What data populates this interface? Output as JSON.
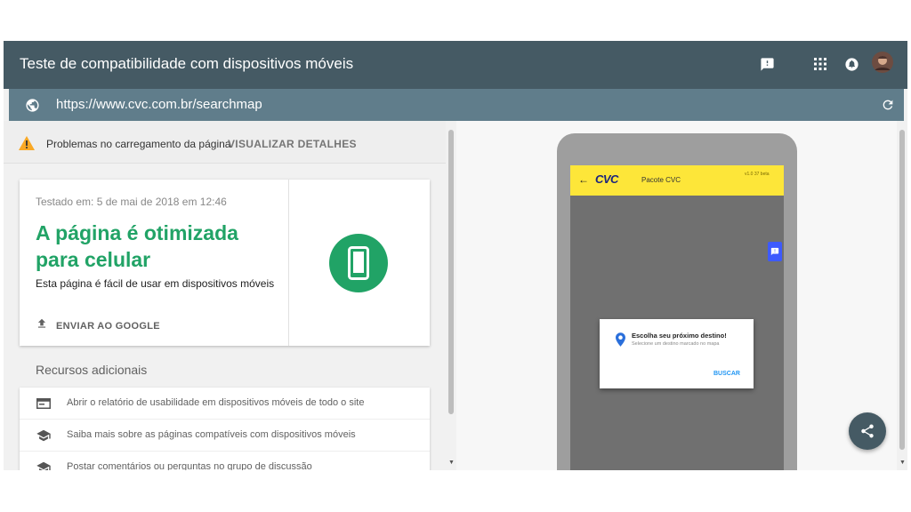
{
  "app": {
    "title": "Teste de compatibilidade com dispositivos móveis"
  },
  "header_icons": [
    "feedback-icon",
    "apps-grid-icon",
    "notifications-icon",
    "account-avatar"
  ],
  "url_bar": {
    "url": "https://www.cvc.com.br/searchmap"
  },
  "warning": {
    "text": "Problemas no carregamento da página",
    "link": "VISUALIZAR DETALHES"
  },
  "result": {
    "tested": "Testado em: 5 de mai de 2018 em 12:46",
    "headline": "A página é otimizada para celular",
    "subtitle": "Esta página é fácil de usar em dispositivos móveis",
    "submit": "ENVIAR AO GOOGLE"
  },
  "resources": {
    "title": "Recursos adicionais",
    "items": [
      {
        "label": "Abrir o relatório de usabilidade em dispositivos móveis de todo o site",
        "icon": "report-icon"
      },
      {
        "label": "Saiba mais sobre as páginas compatíveis com dispositivos móveis",
        "icon": "school-icon"
      },
      {
        "label": "Postar comentários ou perguntas no grupo de discussão",
        "icon": "school-icon"
      }
    ]
  },
  "preview": {
    "logo": "CVC",
    "page_title": "Pacote CVC",
    "version": "v1.0 37 beta",
    "dialog_title": "Escolha seu próximo destino!",
    "dialog_subtitle": "Selecione um destino marcado no mapa",
    "dialog_button": "BUSCAR"
  },
  "colors": {
    "appbar": "#455a64",
    "urlbar": "#607d8b",
    "success": "#21a366",
    "warning": "#f9a825",
    "mobile_header": "#fde639",
    "link_blue": "#2196f3"
  }
}
